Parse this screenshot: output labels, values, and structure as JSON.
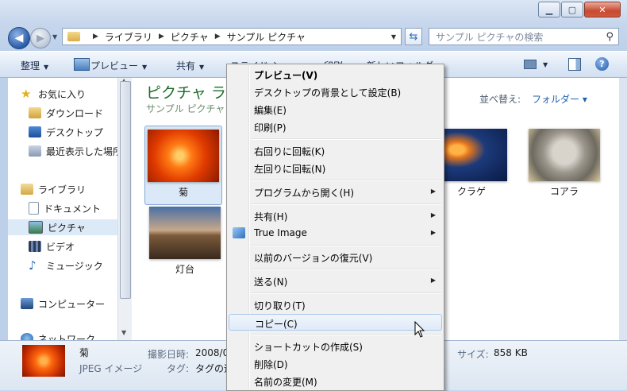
{
  "address": {
    "crumbs": [
      "ライブラリ",
      "ピクチャ",
      "サンプル ピクチャ"
    ]
  },
  "search": {
    "placeholder": "サンプル ピクチャの検索"
  },
  "commands": {
    "organize": "整理",
    "preview": "プレビュー",
    "share": "共有",
    "slideshow": "スライド ショー",
    "print": "印刷",
    "new_folder": "新しいフォルダー"
  },
  "nav": {
    "favorites": "お気に入り",
    "downloads": "ダウンロード",
    "desktop": "デスクトップ",
    "recent": "最近表示した場所",
    "libraries": "ライブラリ",
    "documents": "ドキュメント",
    "pictures": "ピクチャ",
    "videos": "ビデオ",
    "music": "ミュージック",
    "computer": "コンピューター",
    "network": "ネットワーク"
  },
  "content": {
    "heading": "ピクチャ ライブラリ",
    "subheading": "サンプル ピクチャ",
    "sort_label": "並べ替え:",
    "sort_value": "フォルダー ▾"
  },
  "tiles": [
    {
      "label": "菊"
    },
    {
      "label": "灯台"
    },
    {
      "label": "クラゲ"
    },
    {
      "label": "コアラ"
    }
  ],
  "details": {
    "name": "菊",
    "type": "JPEG イメージ",
    "date_label": "撮影日時:",
    "date_value": "2008/0",
    "tag_label": "タグ:",
    "tag_value": "タグの追",
    "size_label": "サイズ:",
    "size_value": "858 KB"
  },
  "menu": {
    "items": [
      "プレビュー(V)",
      "デスクトップの背景として設定(B)",
      "編集(E)",
      "印刷(P)",
      "右回りに回転(K)",
      "左回りに回転(N)",
      "プログラムから開く(H)",
      "共有(H)",
      "True Image",
      "以前のバージョンの復元(V)",
      "送る(N)",
      "切り取り(T)",
      "コピー(C)",
      "ショートカットの作成(S)",
      "削除(D)",
      "名前の変更(M)"
    ]
  }
}
